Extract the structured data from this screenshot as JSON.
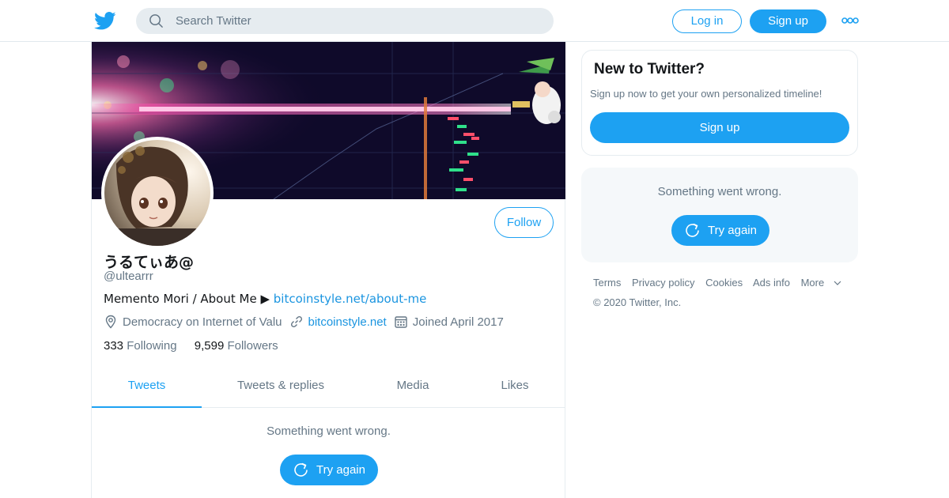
{
  "header": {
    "search_placeholder": "Search Twitter",
    "login_label": "Log in",
    "signup_label": "Sign up"
  },
  "profile": {
    "display_name": "うるてぃあ@",
    "handle": "@ultearrr",
    "bio_text": "Memento Mori / About Me ▶ ",
    "bio_link": "bitcoinstyle.net/about-me",
    "location": "Democracy on Internet of Valu",
    "website": "bitcoinstyle.net",
    "joined": "Joined April 2017",
    "following_count": "333",
    "following_label": "Following",
    "followers_count": "9,599",
    "followers_label": "Followers",
    "follow_label": "Follow"
  },
  "tabs": [
    {
      "label": "Tweets",
      "active": true
    },
    {
      "label": "Tweets & replies",
      "active": false
    },
    {
      "label": "Media",
      "active": false
    },
    {
      "label": "Likes",
      "active": false
    }
  ],
  "timeline": {
    "error_text": "Something went wrong.",
    "retry_label": "Try again"
  },
  "sidebar": {
    "signup_title": "New to Twitter?",
    "signup_text": "Sign up now to get your own personalized timeline!",
    "signup_button": "Sign up",
    "error_text": "Something went wrong.",
    "retry_label": "Try again"
  },
  "footer": {
    "links": [
      "Terms",
      "Privacy policy",
      "Cookies",
      "Ads info",
      "More"
    ],
    "copyright": "© 2020 Twitter, Inc."
  },
  "colors": {
    "accent": "#1da1f2",
    "link": "#1b95e0",
    "muted": "#657786",
    "text": "#14171a"
  }
}
